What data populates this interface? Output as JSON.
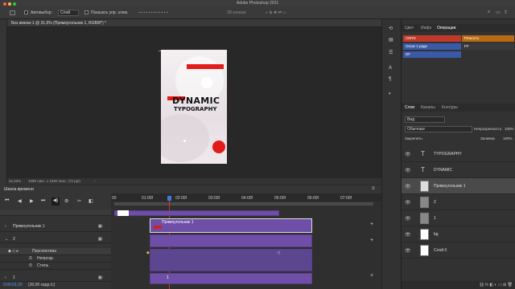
{
  "app": {
    "title": "Adobe Photoshop 2021"
  },
  "options_bar": {
    "autoselect_label": "Автовыбор:",
    "autoselect_value": "Слой",
    "show_transform_label": "Показать упр. элем.",
    "mode_label": "3D-режим:"
  },
  "document": {
    "tab_title": "Без имени-1 @ 31,6% (Прямоугольник 1, RGB/8*) *",
    "zoom": "31,63%",
    "info": "1080 пикс. x 1920 пикс. (72 ppi)",
    "art_title_1": "DYNAMIC",
    "art_title_2": "TYPOGRAPHY"
  },
  "timeline": {
    "title": "Шкала времени",
    "timecode": "0:00:01:20",
    "fps": "(30,00 кадр./с)",
    "ticks": [
      "00",
      "01:00f",
      "02:00f",
      "03:00f",
      "04:00f",
      "05:00f",
      "06:00f",
      "07:00f"
    ],
    "clip_label": "Прямоугольник 1",
    "clip_label2": "1",
    "tracks": [
      {
        "label": "Прямоугольник 1"
      },
      {
        "label": "2"
      },
      {
        "label": "Перспектива"
      },
      {
        "label": "Непрозр."
      },
      {
        "label": "Стиль"
      },
      {
        "label": "1"
      }
    ]
  },
  "color_panel": {
    "tabs": [
      "Цвет",
      "Инфо",
      "Операции"
    ],
    "swatches": [
      {
        "label": "CMYK",
        "color": "#c0392b"
      },
      {
        "label": "Резкость",
        "color": "#b86a10"
      },
      {
        "label": "Oscar 1 page",
        "color": "#3a5aa8"
      },
      {
        "label": "FF",
        "color": "#3a3a3a"
      },
      {
        "label": "DF",
        "color": "#3a5aa8"
      }
    ]
  },
  "layers_panel": {
    "tabs": [
      "Слои",
      "Каналы",
      "Контуры"
    ],
    "filter": "Вид",
    "blend": "Обычные",
    "opacity_label": "Непрозрачность:",
    "opacity": "100%",
    "lock_label": "Закрепить:",
    "fill_label": "Заливка:",
    "fill": "100%",
    "layers": [
      {
        "name": "TYPOGRAPHY",
        "kind": "text"
      },
      {
        "name": "DYNAMIC",
        "kind": "text"
      },
      {
        "name": "Прямоугольник 1",
        "kind": "shape"
      },
      {
        "name": "2",
        "kind": "group"
      },
      {
        "name": "1",
        "kind": "group"
      },
      {
        "name": "bg",
        "kind": "fill"
      },
      {
        "name": "Слой 0",
        "kind": "pixel"
      }
    ]
  }
}
